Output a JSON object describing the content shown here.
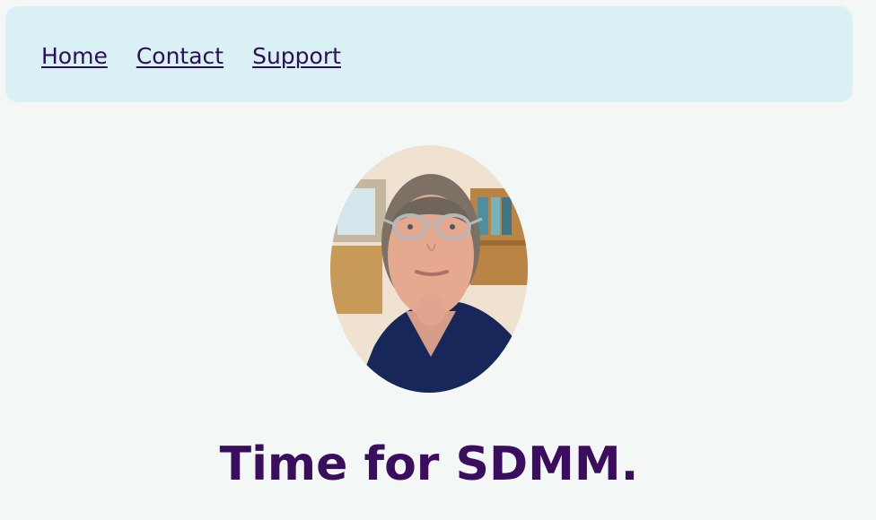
{
  "nav": {
    "links": [
      {
        "label": "Home"
      },
      {
        "label": "Contact"
      },
      {
        "label": "Support"
      }
    ]
  },
  "hero": {
    "headline": "Time for SDMM."
  },
  "colors": {
    "page_background": "#f3f8f7",
    "nav_background": "#d9f1f4",
    "link": "#2d0f57",
    "headline": "#3a0d5f"
  }
}
